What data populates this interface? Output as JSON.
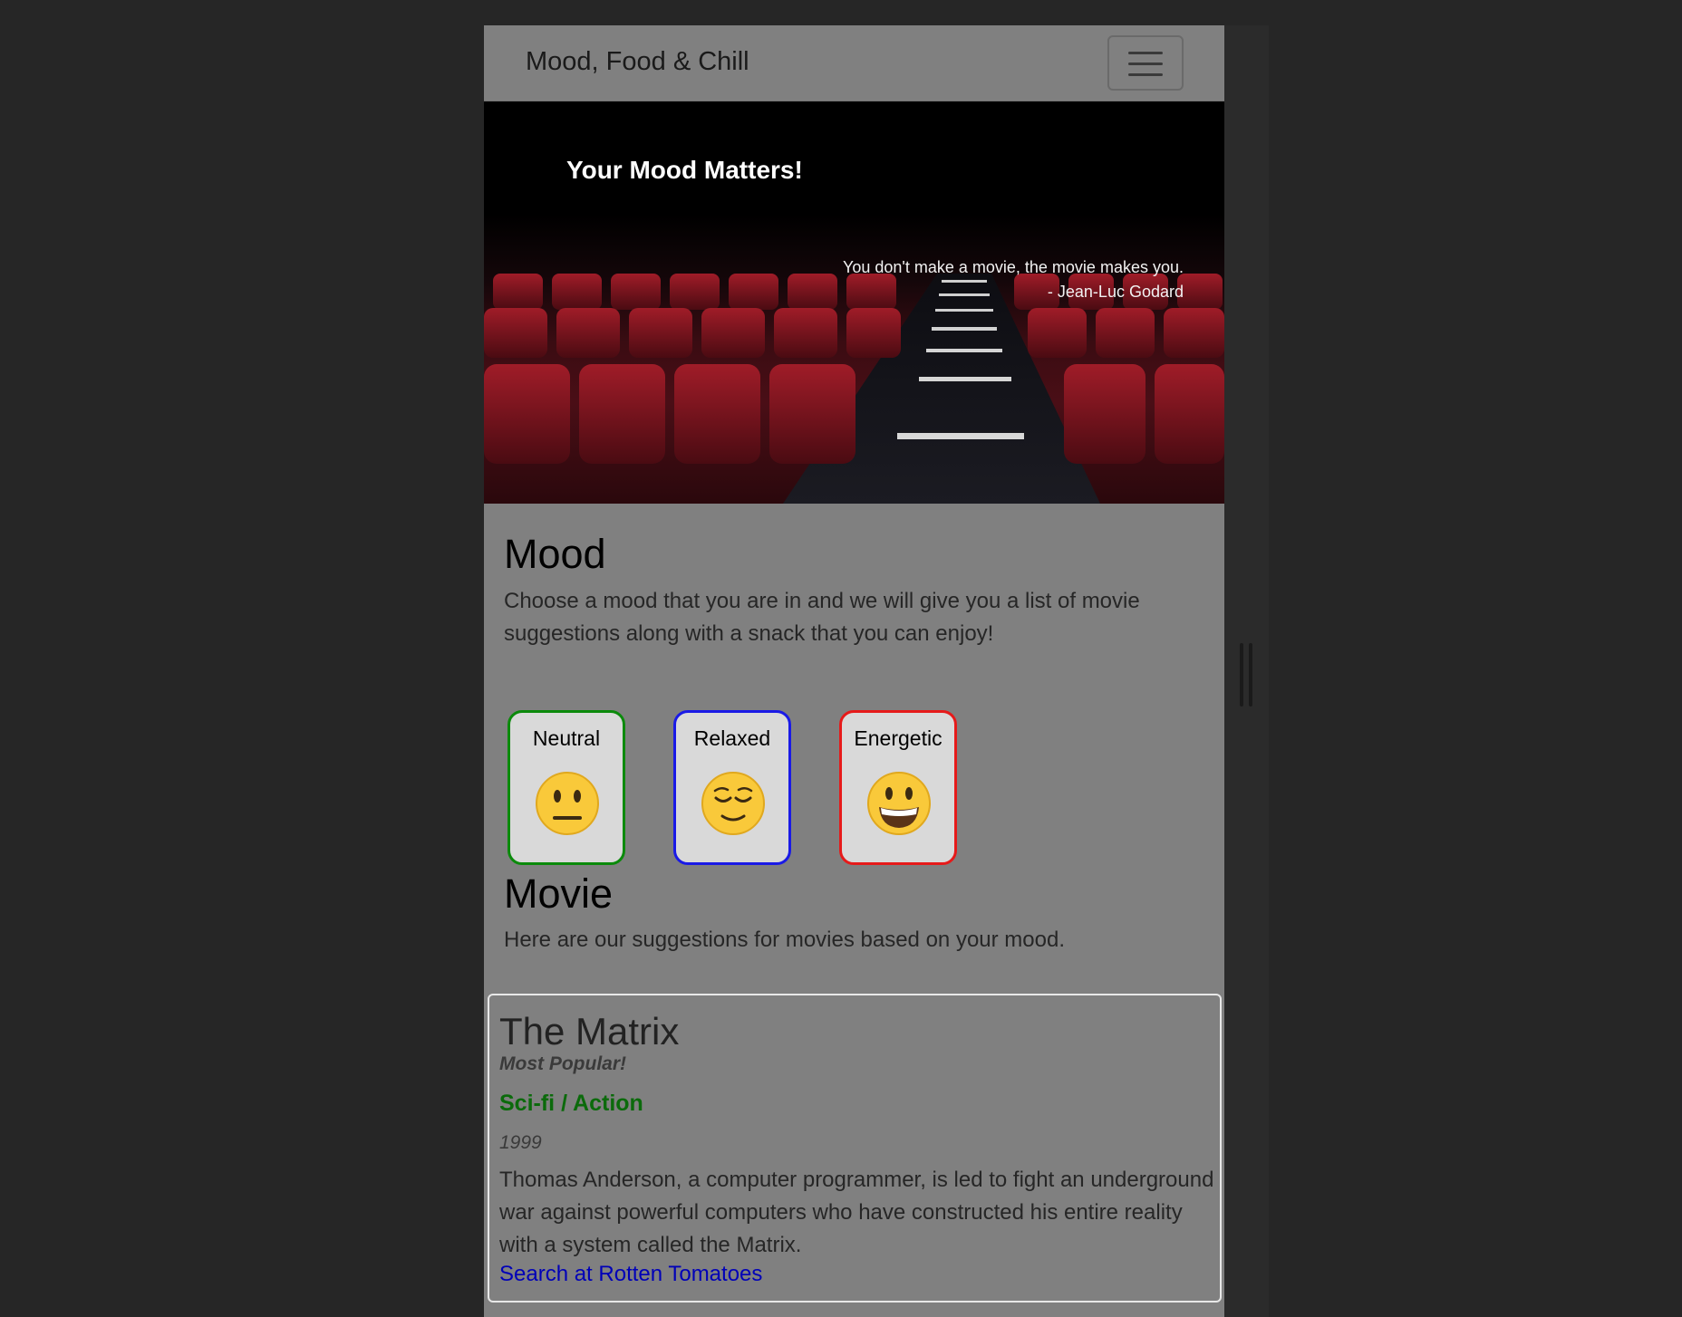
{
  "navbar": {
    "brand": "Mood, Food & Chill",
    "menu_icon": "hamburger-menu-icon"
  },
  "hero": {
    "title": "Your Mood Matters!",
    "quote": "You don't make a movie, the movie makes you.",
    "author": "- Jean-Luc Godard"
  },
  "mood_section": {
    "heading": "Mood",
    "description": "Choose a mood that you are in and we will give you a list of movie suggestions along with a snack that you can enjoy!",
    "moods": [
      {
        "label": "Neutral",
        "icon": "neutral-face-icon",
        "color": "#0b8a0b"
      },
      {
        "label": "Relaxed",
        "icon": "relieved-face-icon",
        "color": "#1a1ae6"
      },
      {
        "label": "Energetic",
        "icon": "grinning-face-icon",
        "color": "#e61a1a"
      }
    ]
  },
  "movie_section": {
    "heading": "Movie",
    "description": "Here are our suggestions for movies based on your mood.",
    "movie": {
      "title": "The Matrix",
      "tag": "Most Popular!",
      "genre": "Sci-fi / Action",
      "year": "1999",
      "description": "Thomas Anderson, a computer programmer, is led to fight an underground war against powerful computers who have constructed his entire reality with a system called the Matrix.",
      "link_label": "Search at Rotten Tomatoes"
    }
  }
}
